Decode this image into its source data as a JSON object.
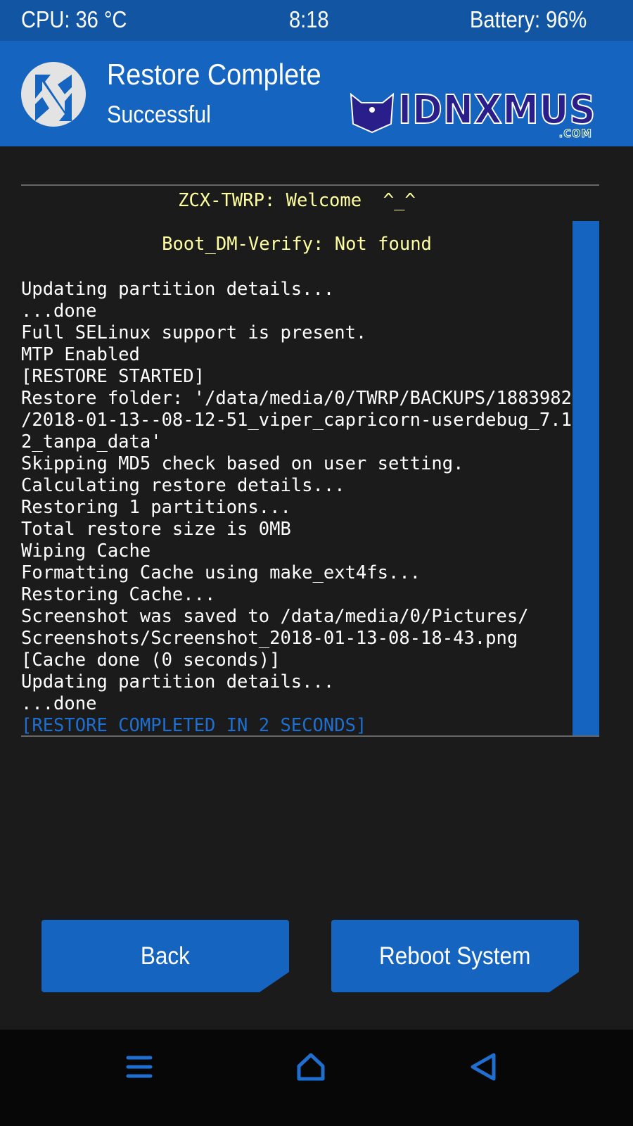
{
  "status_bar": {
    "cpu": "CPU: 36 °C",
    "time": "8:18",
    "battery": "Battery: 96%"
  },
  "header": {
    "title": "Restore Complete",
    "subtitle": "Successful",
    "watermark": "IDNXMUS",
    "watermark_suffix": ".COM"
  },
  "console": {
    "welcome": "ZCX-TWRP: Welcome  ^_^",
    "dm_verify": "Boot_DM-Verify: Not found",
    "lines": [
      "Updating partition details...",
      "...done",
      "Full SELinux support is present.",
      "MTP Enabled",
      "[RESTORE STARTED]",
      "Restore folder: '/data/media/0/TWRP/BACKUPS/1883982",
      "/2018-01-13--08-12-51_viper_capricorn-userdebug_7.1",
      "2_tanpa_data'",
      "Skipping MD5 check based on user setting.",
      "Calculating restore details...",
      "Restoring 1 partitions...",
      "Total restore size is 0MB",
      "Wiping Cache",
      "Formatting Cache using make_ext4fs...",
      "Restoring Cache...",
      "Screenshot was saved to /data/media/0/Pictures/",
      "Screenshots/Screenshot_2018-01-13-08-18-43.png",
      "[Cache done (0 seconds)]",
      "Updating partition details...",
      "...done"
    ],
    "final_line": "[RESTORE COMPLETED IN 2 SECONDS]"
  },
  "buttons": {
    "back": "Back",
    "reboot": "Reboot System"
  },
  "nav": {
    "icons": [
      "menu-icon",
      "home-icon",
      "back-icon"
    ]
  },
  "colors": {
    "accent": "#1565c0",
    "status_bar": "#1255a3",
    "console_highlight": "#ffffa0",
    "final_line": "#1e6fd0",
    "background": "#1b1b1b"
  }
}
